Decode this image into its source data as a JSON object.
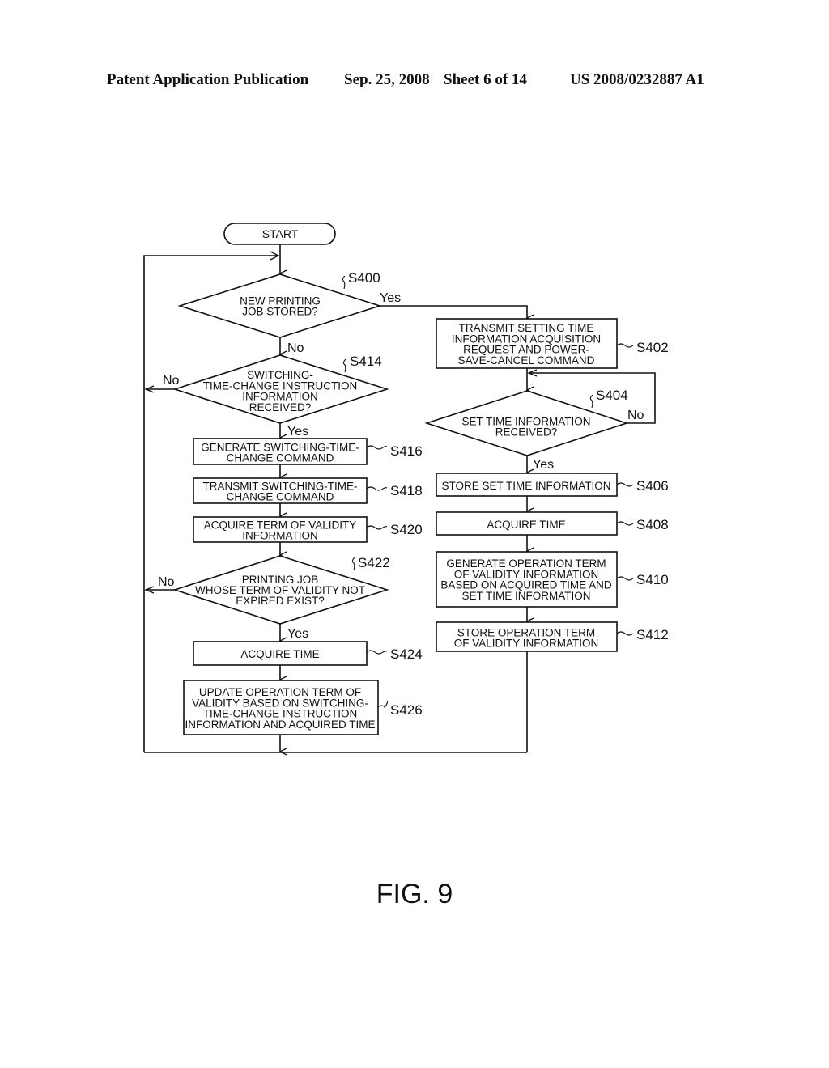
{
  "header": {
    "publication": "Patent Application Publication",
    "date": "Sep. 25, 2008",
    "sheet": "Sheet 6 of 14",
    "number": "US 2008/0232887 A1"
  },
  "figure_label": "FIG. 9",
  "flowchart": {
    "start": "START",
    "nodes": {
      "s400": {
        "id": "S400",
        "type": "decision",
        "lines": [
          "NEW PRINTING",
          "JOB STORED?"
        ]
      },
      "s402": {
        "id": "S402",
        "type": "process",
        "lines": [
          "TRANSMIT SETTING TIME",
          "INFORMATION ACQUISITION",
          "REQUEST AND POWER-",
          "SAVE-CANCEL COMMAND"
        ]
      },
      "s404": {
        "id": "S404",
        "type": "decision",
        "lines": [
          "SET TIME INFORMATION",
          "RECEIVED?"
        ]
      },
      "s406": {
        "id": "S406",
        "type": "process",
        "lines": [
          "STORE SET TIME INFORMATION"
        ]
      },
      "s408": {
        "id": "S408",
        "type": "process",
        "lines": [
          "ACQUIRE TIME"
        ]
      },
      "s410": {
        "id": "S410",
        "type": "process",
        "lines": [
          "GENERATE OPERATION TERM",
          "OF VALIDITY INFORMATION",
          "BASED ON ACQUIRED TIME AND",
          "SET TIME INFORMATION"
        ]
      },
      "s412": {
        "id": "S412",
        "type": "process",
        "lines": [
          "STORE OPERATION TERM",
          "OF VALIDITY INFORMATION"
        ]
      },
      "s414": {
        "id": "S414",
        "type": "decision",
        "lines": [
          "SWITCHING-",
          "TIME-CHANGE INSTRUCTION",
          "INFORMATION",
          "RECEIVED?"
        ]
      },
      "s416": {
        "id": "S416",
        "type": "process",
        "lines": [
          "GENERATE SWITCHING-TIME-",
          "CHANGE COMMAND"
        ]
      },
      "s418": {
        "id": "S418",
        "type": "process",
        "lines": [
          "TRANSMIT SWITCHING-TIME-",
          "CHANGE COMMAND"
        ]
      },
      "s420": {
        "id": "S420",
        "type": "process",
        "lines": [
          "ACQUIRE TERM OF VALIDITY",
          "INFORMATION"
        ]
      },
      "s422": {
        "id": "S422",
        "type": "decision",
        "lines": [
          "PRINTING JOB",
          "WHOSE TERM OF VALIDITY NOT",
          "EXPIRED EXIST?"
        ]
      },
      "s424": {
        "id": "S424",
        "type": "process",
        "lines": [
          "ACQUIRE TIME"
        ]
      },
      "s426": {
        "id": "S426",
        "type": "process",
        "lines": [
          "UPDATE OPERATION TERM OF",
          "VALIDITY BASED ON SWITCHING-",
          "TIME-CHANGE INSTRUCTION",
          "INFORMATION AND ACQUIRED TIME"
        ]
      }
    },
    "branch_labels": {
      "s400_yes": "Yes",
      "s400_no": "No",
      "s414_yes": "Yes",
      "s414_no": "No",
      "s404_yes": "Yes",
      "s404_no": "No",
      "s422_yes": "Yes",
      "s422_no": "No"
    }
  }
}
